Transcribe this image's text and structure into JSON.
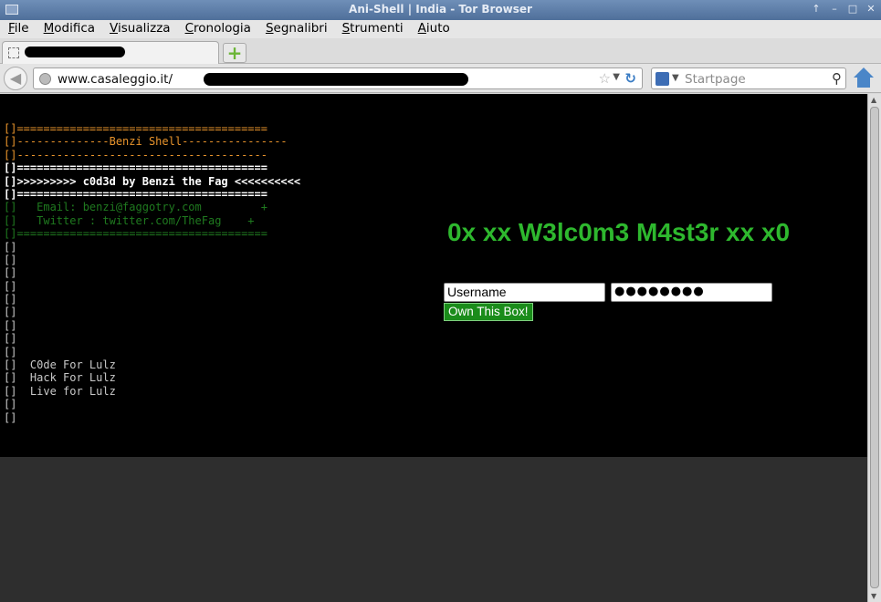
{
  "window": {
    "title": "Ani-Shell | India - Tor Browser",
    "controls": [
      "↑",
      "–",
      "□",
      "✕"
    ]
  },
  "menubar": [
    {
      "first": "F",
      "rest": "ile"
    },
    {
      "first": "M",
      "rest": "odifica"
    },
    {
      "first": "V",
      "rest": "isualizza"
    },
    {
      "first": "C",
      "rest": "ronologia"
    },
    {
      "first": "S",
      "rest": "egnalibri"
    },
    {
      "first": "S",
      "rest": "trumenti"
    },
    {
      "first": "A",
      "rest": "iuto"
    }
  ],
  "tab": {
    "new_tab_icon": "+"
  },
  "navbar": {
    "url": "www.casaleggio.it/",
    "search_placeholder": "Startpage"
  },
  "page": {
    "ascii_lines": [
      {
        "text": "[]======================================",
        "color": "orange"
      },
      {
        "text": "[]--------------Benzi Shell----------------",
        "color": "orange"
      },
      {
        "text": "[]--------------------------------------",
        "color": "orange"
      },
      {
        "text": "[]======================================",
        "color": "white"
      },
      {
        "text": "[]>>>>>>>>> c0d3d by Benzi the Fag <<<<<<<<<<",
        "color": "white"
      },
      {
        "text": "[]======================================",
        "color": "white"
      },
      {
        "text": "[]   Email: benzi@faggotry.com         +",
        "color": "green"
      },
      {
        "text": "[]   Twitter : twitter.com/TheFag    +",
        "color": "green"
      },
      {
        "text": "[]======================================",
        "color": "green"
      },
      {
        "text": "[]",
        "color": "gray"
      },
      {
        "text": "[]",
        "color": "gray"
      },
      {
        "text": "[]",
        "color": "gray"
      },
      {
        "text": "[]",
        "color": "gray"
      },
      {
        "text": "[]",
        "color": "gray"
      },
      {
        "text": "[]",
        "color": "gray"
      },
      {
        "text": "[]",
        "color": "gray"
      },
      {
        "text": "[]",
        "color": "gray"
      },
      {
        "text": "[]",
        "color": "gray"
      },
      {
        "text": "[]  C0de For Lulz",
        "color": "gray"
      },
      {
        "text": "[]  Hack For Lulz",
        "color": "gray"
      },
      {
        "text": "[]  Live for Lulz",
        "color": "gray"
      },
      {
        "text": "[]",
        "color": "gray"
      },
      {
        "text": "[]",
        "color": "gray"
      }
    ],
    "welcome": "0x xx W3lc0m3 M4st3r xx x0",
    "login": {
      "username_value": "Username",
      "password_value": "●●●●●●●●",
      "button_label": "Own This Box!"
    }
  },
  "colors": {
    "orange": "#e9942c",
    "green_text": "#2eb82e",
    "dark_green": "#1f7a1f",
    "button_green": "#1a8c1a"
  }
}
